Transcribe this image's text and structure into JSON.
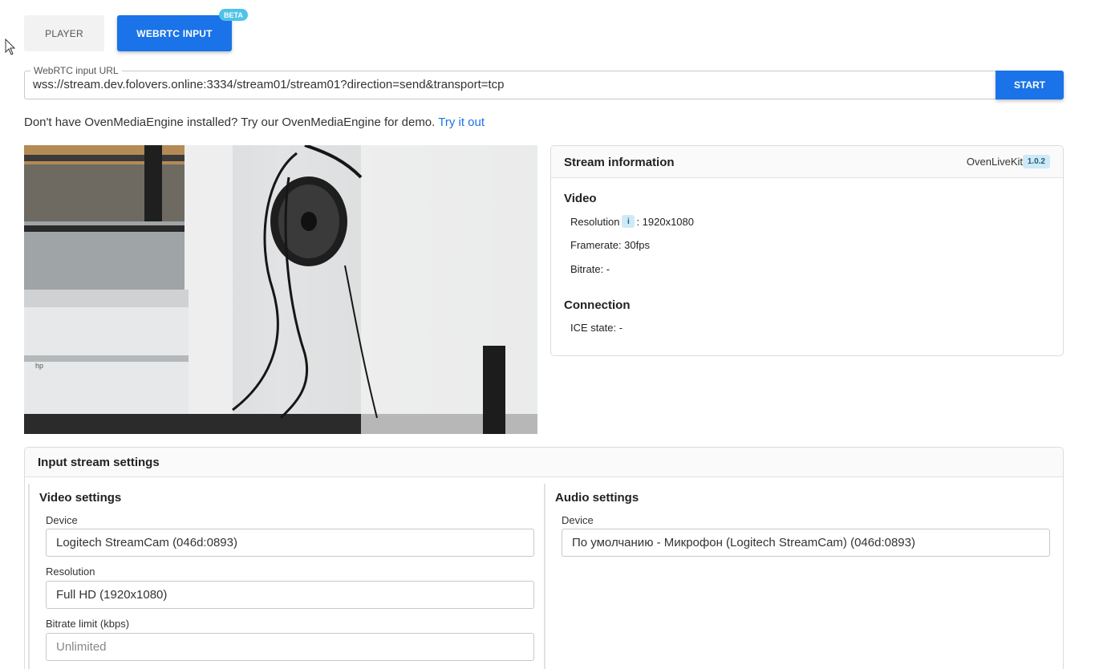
{
  "tabs": {
    "player_label": "PLAYER",
    "webrtc_label": "WEBRTC INPUT",
    "beta_badge": "BETA"
  },
  "url_field": {
    "legend": "WebRTC input URL",
    "value": "wss://stream.dev.folovers.online:3334/stream01/stream01?direction=send&transport=tcp",
    "start_label": "START"
  },
  "note": {
    "text": "Don't have OvenMediaEngine installed? Try our OvenMediaEngine for demo.",
    "link": "Try it out"
  },
  "stream_info": {
    "title": "Stream information",
    "lib_name": "OvenLiveKit",
    "lib_version": "1.0.2",
    "video_heading": "Video",
    "resolution_label": "Resolution",
    "info_icon": "i",
    "resolution_value": ": 1920x1080",
    "framerate": "Framerate: 30fps",
    "bitrate": "Bitrate: -",
    "connection_heading": "Connection",
    "ice_state": "ICE state: -"
  },
  "input_settings": {
    "title": "Input stream settings",
    "video": {
      "heading": "Video settings",
      "device_label": "Device",
      "device_value": "Logitech StreamCam (046d:0893)",
      "resolution_label": "Resolution",
      "resolution_value": "Full HD (1920x1080)",
      "bitrate_label": "Bitrate limit (kbps)",
      "bitrate_placeholder": "Unlimited"
    },
    "audio": {
      "heading": "Audio settings",
      "device_label": "Device",
      "device_value": "По умолчанию - Микрофон (Logitech StreamCam) (046d:0893)"
    }
  },
  "colors": {
    "accent": "#1a73e8",
    "badge": "#4fc3e8"
  }
}
